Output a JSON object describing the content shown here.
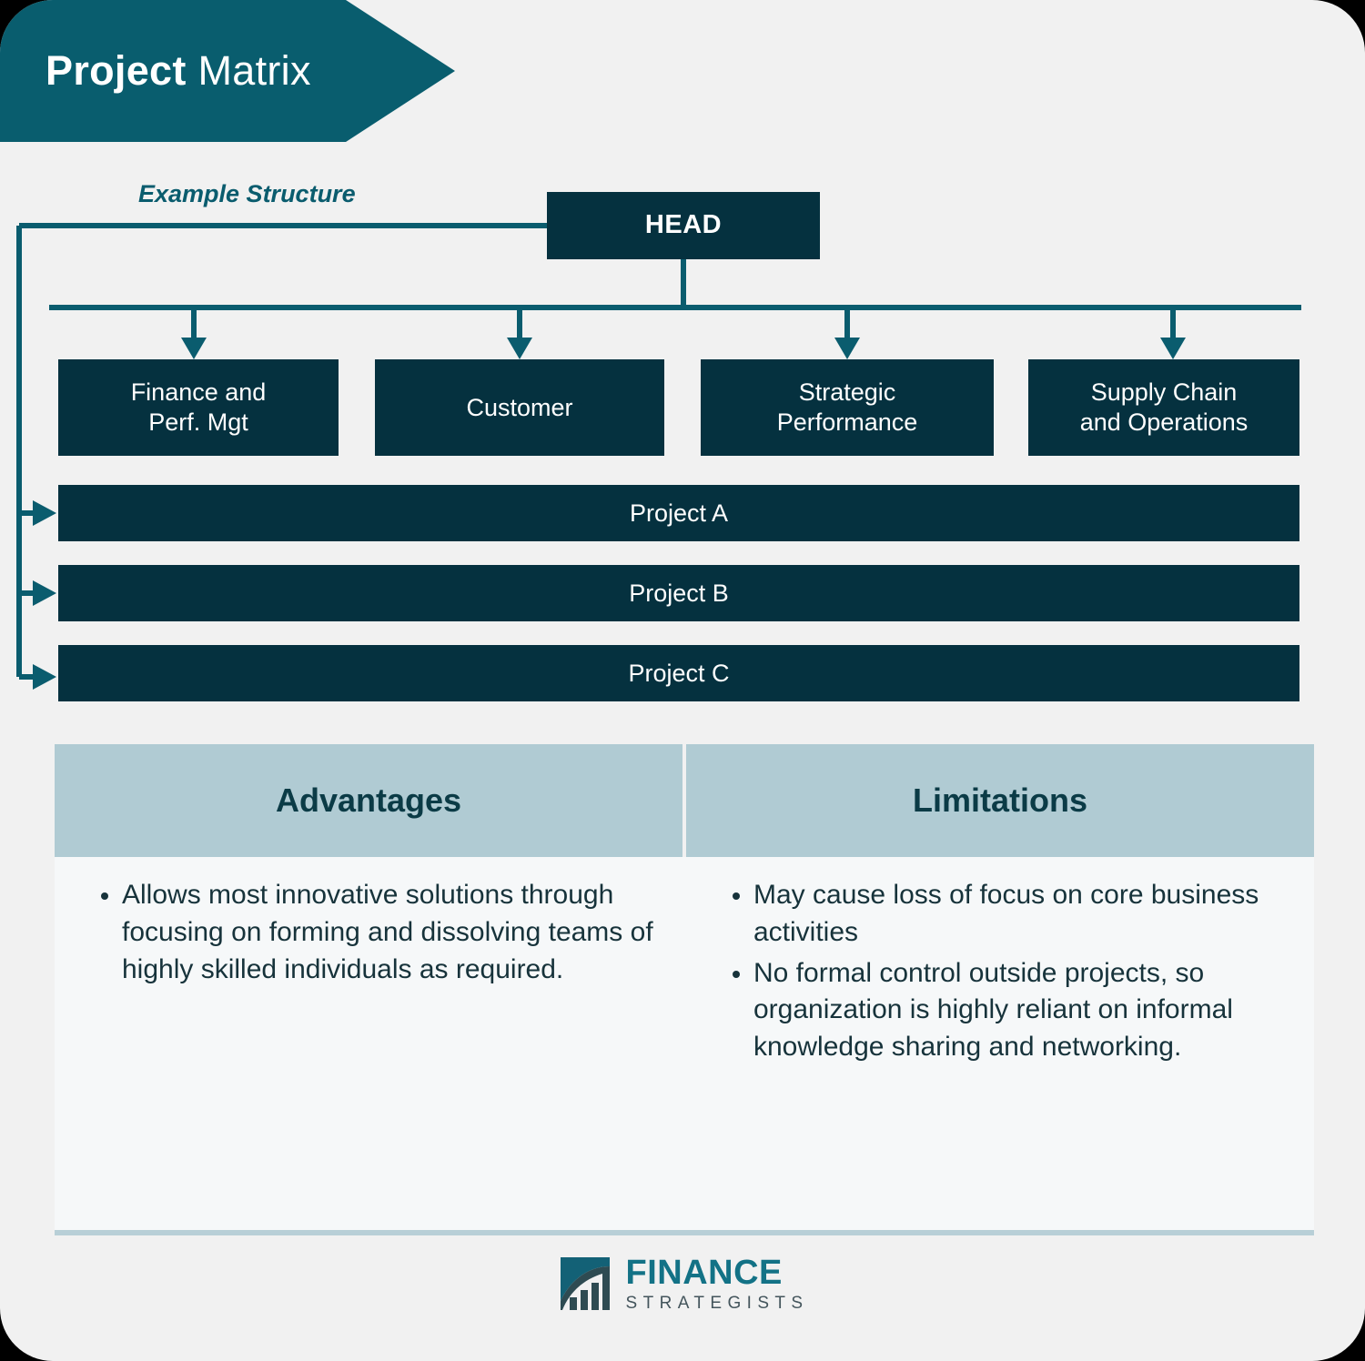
{
  "header": {
    "title_bold": "Project",
    "title_rest": " Matrix",
    "banner_color": "#095D6E"
  },
  "chart": {
    "subtitle": "Example Structure",
    "node_color": "#05313F",
    "connector_color": "#0A5C6E",
    "head": {
      "label": "HEAD"
    },
    "departments": [
      {
        "label": "Finance and\nPerf. Mgt"
      },
      {
        "label": "Customer"
      },
      {
        "label": "Strategic\nPerformance"
      },
      {
        "label": "Supply Chain\nand Operations"
      }
    ],
    "projects": [
      {
        "label": "Project A"
      },
      {
        "label": "Project B"
      },
      {
        "label": "Project C"
      }
    ]
  },
  "comparison": {
    "header_bg": "#B0CBD3",
    "columns": [
      {
        "title": "Advantages",
        "items": [
          "Allows most innovative solutions through focusing on forming and dissolving teams of highly skilled individuals as required."
        ]
      },
      {
        "title": "Limitations",
        "items": [
          "May cause loss of focus on core business activities",
          "No formal control outside projects, so organization is highly reliant on informal knowledge sharing and networking."
        ]
      }
    ]
  },
  "footer": {
    "brand_primary": "FINANCE",
    "brand_secondary": "STRATEGISTS",
    "brand_color": "#137286",
    "brand_secondary_color": "#44555C"
  }
}
